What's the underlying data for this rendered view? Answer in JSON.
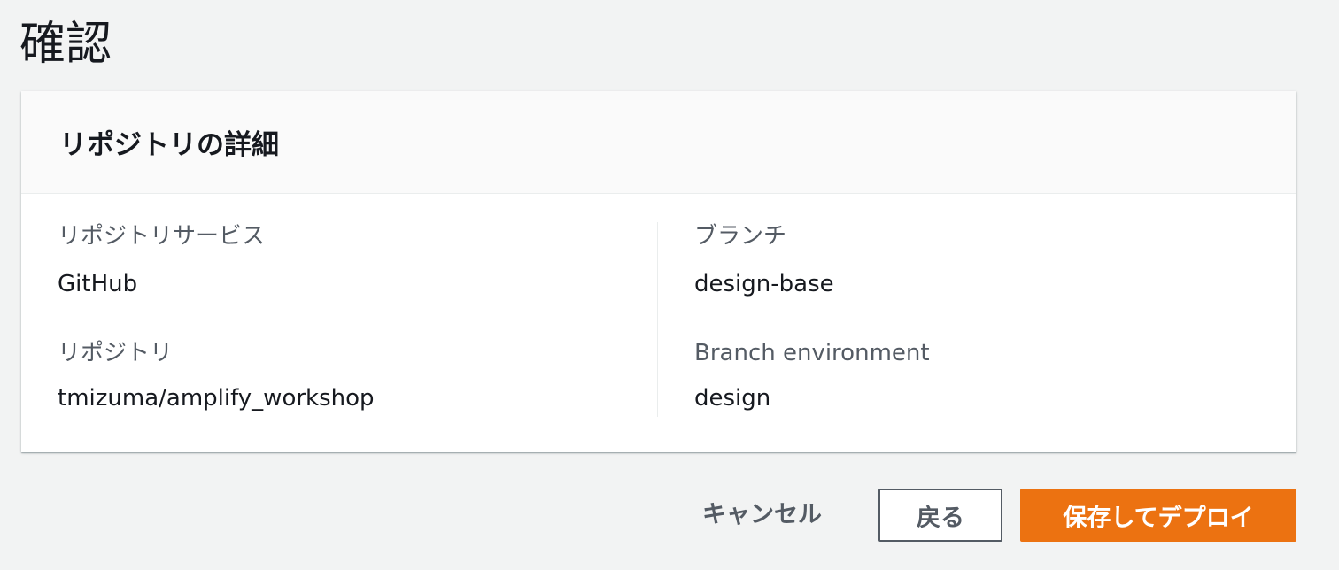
{
  "page": {
    "title": "確認"
  },
  "repository_details": {
    "heading": "リポジトリの詳細",
    "left_column": [
      {
        "label": "リポジトリサービス",
        "value": "GitHub"
      },
      {
        "label": "リポジトリ",
        "value": "tmizuma/amplify_workshop"
      }
    ],
    "right_column": [
      {
        "label": "ブランチ",
        "value": "design-base"
      },
      {
        "label": "Branch environment",
        "value": "design"
      }
    ]
  },
  "actions": {
    "cancel_label": "キャンセル",
    "back_label": "戻る",
    "save_deploy_label": "保存してデプロイ"
  },
  "colors": {
    "page_background": "#f2f3f3",
    "primary_button": "#ec7211",
    "label_text": "#545b64",
    "value_text": "#16191f"
  }
}
